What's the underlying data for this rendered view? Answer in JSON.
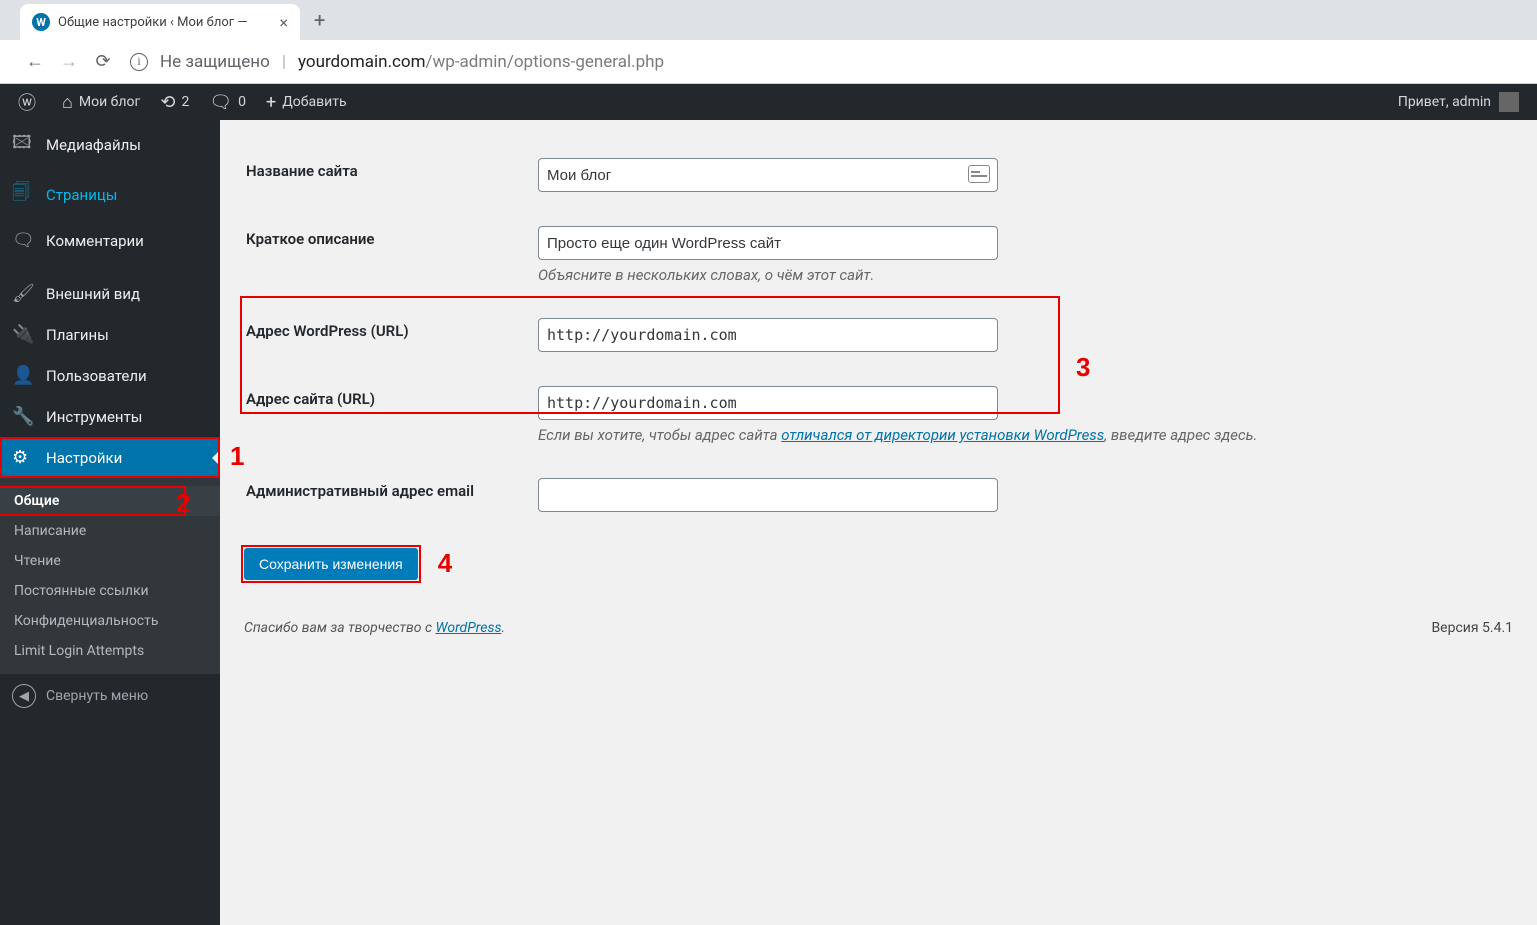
{
  "browser": {
    "tab_title": "Общие настройки ‹ Мои блог —",
    "security_label": "Не защищено",
    "url_domain": "yourdomain.com",
    "url_path": "/wp-admin/options-general.php"
  },
  "adminbar": {
    "site_name": "Мои блог",
    "updates": "2",
    "comments": "0",
    "new_label": "Добавить",
    "greeting": "Привет, admin"
  },
  "sidebar": {
    "media": "Медиафайлы",
    "pages": "Страницы",
    "comments": "Комментарии",
    "appearance": "Внешний вид",
    "plugins": "Плагины",
    "users": "Пользователи",
    "tools": "Инструменты",
    "settings": "Настройки",
    "collapse": "Свернуть меню",
    "submenu": {
      "general": "Общие",
      "writing": "Написание",
      "reading": "Чтение",
      "permalinks": "Постоянные ссылки",
      "privacy": "Конфиденциальность",
      "limit_login": "Limit Login Attempts"
    }
  },
  "form": {
    "site_name_label": "Название сайта",
    "site_name_value": "Мои блог",
    "tagline_label": "Краткое описание",
    "tagline_value": "Просто еще один WordPress сайт",
    "tagline_desc": "Объясните в нескольких словах, о чём этот сайт.",
    "wp_url_label": "Адрес WordPress (URL)",
    "wp_url_value": "http://yourdomain.com",
    "site_url_label": "Адрес сайта (URL)",
    "site_url_value": "http://yourdomain.com",
    "site_url_desc_1": "Если вы хотите, чтобы адрес сайта ",
    "site_url_desc_link": "отличался от директории установки WordPress",
    "site_url_desc_2": ", введите адрес здесь.",
    "admin_email_label": "Административный адрес email",
    "admin_email_value": "",
    "submit_label": "Сохранить изменения"
  },
  "footer": {
    "thanks_1": "Спасибо вам за творчество с ",
    "thanks_link": "WordPress",
    "thanks_2": ".",
    "version": "Версия 5.4.1"
  },
  "annotations": {
    "n1": "1",
    "n2": "2",
    "n3": "3",
    "n4": "4"
  }
}
